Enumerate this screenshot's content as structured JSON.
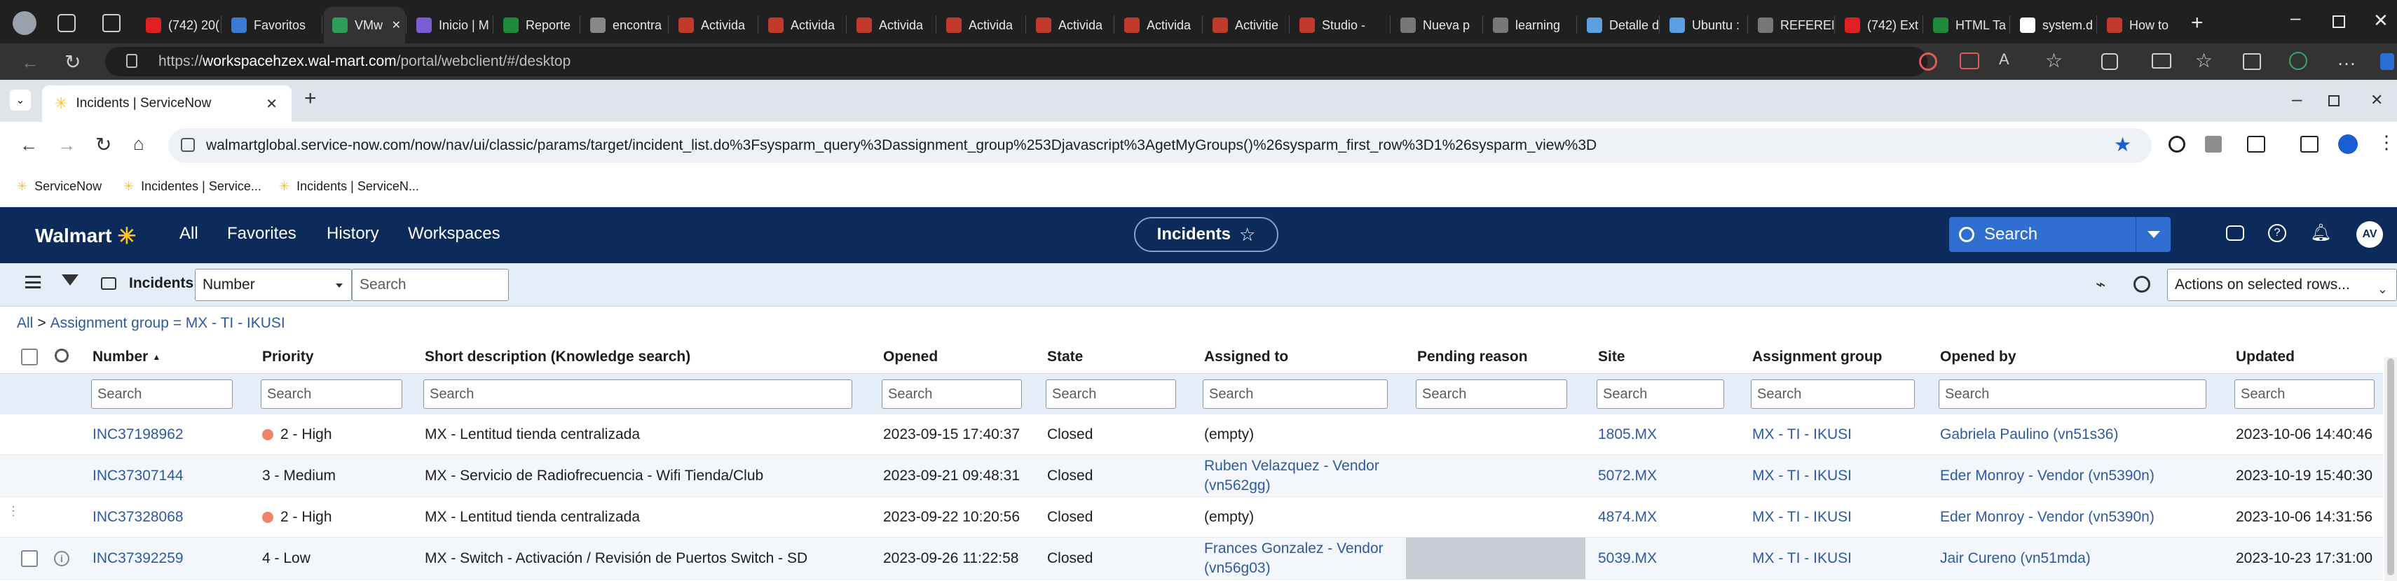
{
  "outer_browser": {
    "tabs": [
      {
        "label": "(742) 20(",
        "color": "#e02020"
      },
      {
        "label": "Favoritos",
        "color": "#3a7bd5"
      },
      {
        "label": "VMw",
        "color": "#2e9e5b",
        "active": true
      },
      {
        "label": "Inicio | M",
        "color": "#7b5cd6"
      },
      {
        "label": "Reporte",
        "color": "#1f8a3a"
      },
      {
        "label": "encontra",
        "color": "#888888"
      },
      {
        "label": "Activida",
        "color": "#c0392b"
      },
      {
        "label": "Activida",
        "color": "#c0392b"
      },
      {
        "label": "Activida",
        "color": "#c0392b"
      },
      {
        "label": "Activida",
        "color": "#c0392b"
      },
      {
        "label": "Activida",
        "color": "#c0392b"
      },
      {
        "label": "Activida",
        "color": "#c0392b"
      },
      {
        "label": "Activitie",
        "color": "#c0392b"
      },
      {
        "label": "Studio -",
        "color": "#c0392b"
      },
      {
        "label": "Nueva p",
        "color": "#777777"
      },
      {
        "label": "learning",
        "color": "#777777"
      },
      {
        "label": "Detalle d",
        "color": "#5aa0e0"
      },
      {
        "label": "Ubuntu :",
        "color": "#5aa0e0"
      },
      {
        "label": "REFEREN",
        "color": "#777777"
      },
      {
        "label": "(742) Ext",
        "color": "#e02020"
      },
      {
        "label": "HTML Ta",
        "color": "#1f8a3a"
      },
      {
        "label": "system.d",
        "color": "#ffffff"
      },
      {
        "label": "How to",
        "color": "#c0392b"
      }
    ],
    "url_prefix": "https://",
    "url_host": "workspacehzex.wal-mart.com",
    "url_path": "/portal/webclient/#/desktop"
  },
  "inner_browser": {
    "tab_title": "Incidents | ServiceNow",
    "url": "walmartglobal.service-now.com/now/nav/ui/classic/params/target/incident_list.do%3Fsysparm_query%3Dassignment_group%253Djavascript%3AgetMyGroups()%26sysparm_first_row%3D1%26sysparm_view%3D",
    "bookmarks": [
      "ServiceNow",
      "Incidentes | Service...",
      "Incidents | ServiceN..."
    ]
  },
  "sn": {
    "brand": "Walmart",
    "nav": [
      "All",
      "Favorites",
      "History",
      "Workspaces"
    ],
    "context": "Incidents",
    "search_label": "Search",
    "avatar": "AV",
    "colors": {
      "header": "#0c2a5a",
      "search": "#2f6fd1",
      "spark": "#ffc220"
    }
  },
  "toolbar": {
    "list_title": "Incidents",
    "field_select": "Number",
    "search_placeholder": "Search",
    "actions": "Actions on selected rows..."
  },
  "breadcrumb": {
    "all": "All",
    "sep": ">",
    "filter": "Assignment group = MX - TI - IKUSI"
  },
  "columns": [
    "Number",
    "Priority",
    "Short description (Knowledge search)",
    "Opened",
    "State",
    "Assigned to",
    "Pending reason",
    "Site",
    "Assignment group",
    "Opened by",
    "Updated"
  ],
  "column_search_placeholder": "Search",
  "rows": [
    {
      "number": "INC37198962",
      "priority": "2 - High",
      "priority_dot": true,
      "short_description": "MX - Lentitud tienda centralizada",
      "opened": "2023-09-15 17:40:37",
      "state": "Closed",
      "assigned_to": "(empty)",
      "assigned_link": false,
      "pending_reason": "",
      "site": "1805.MX",
      "assignment_group": "MX - TI - IKUSI",
      "opened_by": "Gabriela Paulino (vn51s36)",
      "updated": "2023-10-06 14:40:46"
    },
    {
      "number": "INC37307144",
      "priority": "3 - Medium",
      "priority_dot": false,
      "short_description": "MX - Servicio de Radiofrecuencia - Wifi Tienda/Club",
      "opened": "2023-09-21 09:48:31",
      "state": "Closed",
      "assigned_to": "Ruben Velazquez - Vendor (vn562gg)",
      "assigned_link": true,
      "pending_reason": "",
      "site": "5072.MX",
      "assignment_group": "MX - TI - IKUSI",
      "opened_by": "Eder Monroy - Vendor (vn5390n)",
      "updated": "2023-10-19 15:40:30"
    },
    {
      "number": "INC37328068",
      "priority": "2 - High",
      "priority_dot": true,
      "short_description": "MX - Lentitud tienda centralizada",
      "opened": "2023-09-22 10:20:56",
      "state": "Closed",
      "assigned_to": "(empty)",
      "assigned_link": false,
      "pending_reason": "",
      "site": "4874.MX",
      "assignment_group": "MX - TI - IKUSI",
      "opened_by": "Eder Monroy - Vendor (vn5390n)",
      "updated": "2023-10-06 14:31:56"
    },
    {
      "number": "INC37392259",
      "priority": "4 - Low",
      "priority_dot": false,
      "short_description": "MX - Switch - Activación / Revisión de Puertos Switch - SD",
      "opened": "2023-09-26 11:22:58",
      "state": "Closed",
      "assigned_to": "Frances Gonzalez - Vendor (vn56g03)",
      "assigned_link": true,
      "pending_reason": "",
      "site": "5039.MX",
      "assignment_group": "MX - TI - IKUSI",
      "opened_by": "Jair Cureno (vn51mda)",
      "updated": "2023-10-23 17:31:00"
    }
  ]
}
